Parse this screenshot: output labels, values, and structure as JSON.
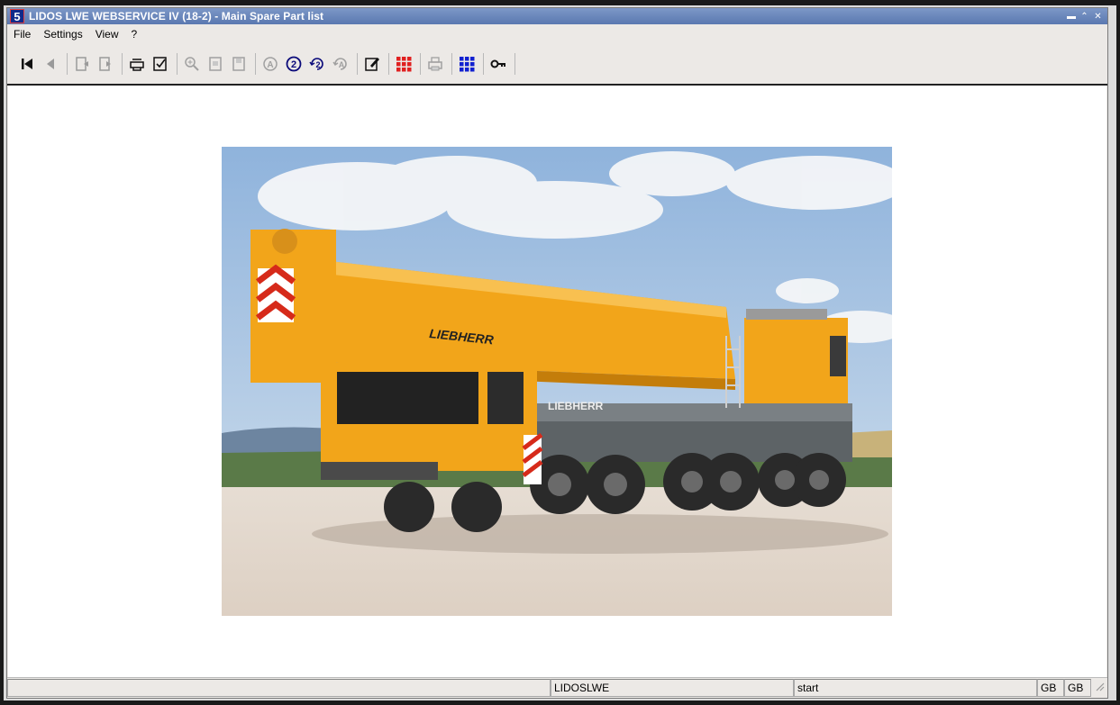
{
  "window": {
    "logo": "5",
    "title": "LIDOS LWE WEBSERVICE IV (18-2) - Main Spare Part list",
    "controls": [
      "minimize-icon",
      "restore-icon",
      "close-icon"
    ]
  },
  "menu": {
    "file": "File",
    "settings": "Settings",
    "view": "View",
    "help": "?"
  },
  "toolbar": {
    "icons": [
      "first-page-icon",
      "previous-icon",
      "back-document-icon",
      "forward-document-icon",
      "print-list-icon",
      "edit-checklist-icon",
      "zoom-in-icon",
      "page-icon",
      "page-save-icon",
      "search-a-icon",
      "search-2-icon",
      "refresh-2-icon",
      "refresh-a-icon",
      "edit-note-icon",
      "grid-red-icon",
      "printer-icon",
      "grid-blue-icon",
      "key-icon"
    ],
    "colors": {
      "grid_red": "#e02020",
      "grid_blue": "#1020d0"
    }
  },
  "image": {
    "subject": "mobile crane",
    "boom_text": "LIEBHERR",
    "cab_text": "LIEBHERR",
    "colors": {
      "sky": "#9fc0e4",
      "crane": "#f2a51a",
      "ground": "#e3d8cc"
    }
  },
  "status": {
    "left": "",
    "server": "LIDOSLWE",
    "state": "start",
    "lang1": "GB",
    "lang2": "GB"
  }
}
